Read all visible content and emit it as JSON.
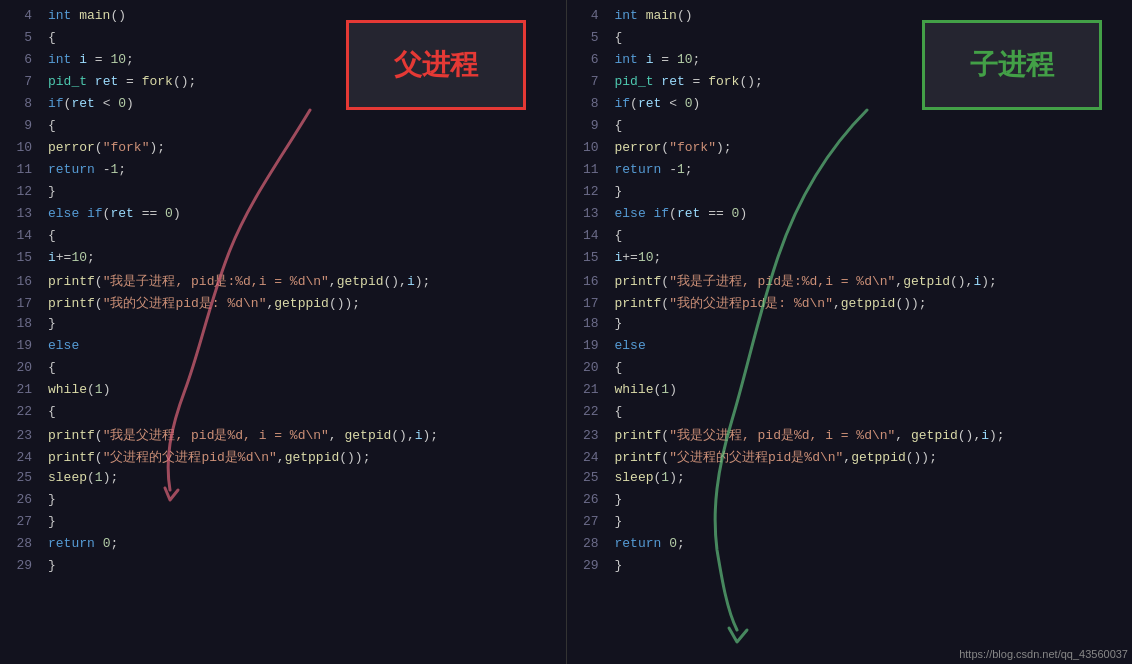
{
  "left": {
    "label": "父进程",
    "lines": [
      {
        "num": "4",
        "content": "<span class='kw'>int</span> <span class='fn'>main</span><span class='punc'>()</span>"
      },
      {
        "num": "5",
        "content": "<span class='punc'>{</span>"
      },
      {
        "num": "6",
        "content": "    <span class='kw'>int</span> <span class='var'>i</span> <span class='op'>=</span> <span class='num'>10</span><span class='punc'>;</span>"
      },
      {
        "num": "7",
        "content": "    <span class='type'>pid_t</span> <span class='var'>ret</span> <span class='op'>=</span> <span class='fn'>fork</span><span class='punc'>();</span>"
      },
      {
        "num": "8",
        "content": "    <span class='kw'>if</span><span class='punc'>(</span><span class='var'>ret</span> <span class='op'>&lt;</span> <span class='num'>0</span><span class='punc'>)</span>"
      },
      {
        "num": "9",
        "content": "    <span class='punc'>{</span>"
      },
      {
        "num": "10",
        "content": "        <span class='fn'>perror</span><span class='punc'>(</span><span class='str'>\"fork\"</span><span class='punc'>);</span>"
      },
      {
        "num": "11",
        "content": "        <span class='kw'>return</span> <span class='op'>-</span><span class='num'>1</span><span class='punc'>;</span>"
      },
      {
        "num": "12",
        "content": "    <span class='punc'>}</span>"
      },
      {
        "num": "13",
        "content": "    <span class='kw'>else if</span><span class='punc'>(</span><span class='var'>ret</span> <span class='op'>==</span> <span class='num'>0</span><span class='punc'>)</span>"
      },
      {
        "num": "14",
        "content": "    <span class='punc'>{</span>"
      },
      {
        "num": "15",
        "content": "        <span class='var'>i</span><span class='op'>+=</span><span class='num'>10</span><span class='punc'>;</span>"
      },
      {
        "num": "16",
        "content": "        <span class='fn'>printf</span><span class='punc'>(</span><span class='str'>\"我是子进程, pid是:%d,i = %d\\n\"</span><span class='punc'>,</span><span class='fn'>getpid</span><span class='punc'>(),</span><span class='var'>i</span><span class='punc'>);</span>"
      },
      {
        "num": "17",
        "content": "        <span class='fn'>printf</span><span class='punc'>(</span><span class='str'>\"我的父进程pid是: %d\\n\"</span><span class='punc'>,</span><span class='fn'>getppid</span><span class='punc'>());</span>"
      },
      {
        "num": "18",
        "content": "    <span class='punc'>}</span>"
      },
      {
        "num": "19",
        "content": "    <span class='kw'>else</span>"
      },
      {
        "num": "20",
        "content": "    <span class='punc'>{</span>"
      },
      {
        "num": "21",
        "content": "        <span class='fn'>while</span><span class='punc'>(</span><span class='num'>1</span><span class='punc'>)</span>"
      },
      {
        "num": "22",
        "content": "        <span class='punc'>{</span>"
      },
      {
        "num": "23",
        "content": "            <span class='fn'>printf</span><span class='punc'>(</span><span class='str'>\"我是父进程, pid是%d, i = %d\\n\"</span><span class='punc'>,</span> <span class='fn'>getpid</span><span class='punc'>(),</span><span class='var'>i</span><span class='punc'>);</span>"
      },
      {
        "num": "24",
        "content": "            <span class='fn'>printf</span><span class='punc'>(</span><span class='str'>\"父进程的父进程pid是%d\\n\"</span><span class='punc'>,</span><span class='fn'>getppid</span><span class='punc'>());</span>"
      },
      {
        "num": "25",
        "content": "            <span class='fn'>sleep</span><span class='punc'>(</span><span class='num'>1</span><span class='punc'>);</span>"
      },
      {
        "num": "26",
        "content": "        <span class='punc'>}</span>"
      },
      {
        "num": "27",
        "content": "    <span class='punc'>}</span>"
      },
      {
        "num": "28",
        "content": "    <span class='kw'>return</span> <span class='num'>0</span><span class='punc'>;</span>"
      },
      {
        "num": "29",
        "content": "<span class='punc'>}</span>"
      }
    ]
  },
  "right": {
    "label": "子进程",
    "lines": [
      {
        "num": "4",
        "content": "<span class='kw'>int</span> <span class='fn'>main</span><span class='punc'>()</span>"
      },
      {
        "num": "5",
        "content": "<span class='punc'>{</span>"
      },
      {
        "num": "6",
        "content": "    <span class='kw'>int</span> <span class='var'>i</span> <span class='op'>=</span> <span class='num'>10</span><span class='punc'>;</span>"
      },
      {
        "num": "7",
        "content": "    <span class='type'>pid_t</span> <span class='var'>ret</span> <span class='op'>=</span> <span class='fn'>fork</span><span class='punc'>();</span>"
      },
      {
        "num": "8",
        "content": "    <span class='kw'>if</span><span class='punc'>(</span><span class='var'>ret</span> <span class='op'>&lt;</span> <span class='num'>0</span><span class='punc'>)</span>"
      },
      {
        "num": "9",
        "content": "    <span class='punc'>{</span>"
      },
      {
        "num": "10",
        "content": "        <span class='fn'>perror</span><span class='punc'>(</span><span class='str'>\"fork\"</span><span class='punc'>);</span>"
      },
      {
        "num": "11",
        "content": "        <span class='kw'>return</span> <span class='op'>-</span><span class='num'>1</span><span class='punc'>;</span>"
      },
      {
        "num": "12",
        "content": "    <span class='punc'>}</span>"
      },
      {
        "num": "13",
        "content": "    <span class='kw'>else if</span><span class='punc'>(</span><span class='var'>ret</span> <span class='op'>==</span> <span class='num'>0</span><span class='punc'>)</span>"
      },
      {
        "num": "14",
        "content": "    <span class='punc'>{</span>"
      },
      {
        "num": "15",
        "content": "        <span class='var'>i</span><span class='op'>+=</span><span class='num'>10</span><span class='punc'>;</span>"
      },
      {
        "num": "16",
        "content": "        <span class='fn'>printf</span><span class='punc'>(</span><span class='str'>\"我是子进程, pid是:%d,i = %d\\n\"</span><span class='punc'>,</span><span class='fn'>getpid</span><span class='punc'>(),</span><span class='var'>i</span><span class='punc'>);</span>"
      },
      {
        "num": "17",
        "content": "        <span class='fn'>printf</span><span class='punc'>(</span><span class='str'>\"我的父进程pid是: %d\\n\"</span><span class='punc'>,</span><span class='fn'>getppid</span><span class='punc'>());</span>"
      },
      {
        "num": "18",
        "content": "    <span class='punc'>}</span>"
      },
      {
        "num": "19",
        "content": "    <span class='kw'>else</span>"
      },
      {
        "num": "20",
        "content": "    <span class='punc'>{</span>"
      },
      {
        "num": "21",
        "content": "        <span class='fn'>while</span><span class='punc'>(</span><span class='num'>1</span><span class='punc'>)</span>"
      },
      {
        "num": "22",
        "content": "        <span class='punc'>{</span>"
      },
      {
        "num": "23",
        "content": "            <span class='fn'>printf</span><span class='punc'>(</span><span class='str'>\"我是父进程, pid是%d, i = %d\\n\"</span><span class='punc'>,</span> <span class='fn'>getpid</span><span class='punc'>(),</span><span class='var'>i</span><span class='punc'>);</span>"
      },
      {
        "num": "24",
        "content": "            <span class='fn'>printf</span><span class='punc'>(</span><span class='str'>\"父进程的父进程pid是%d\\n\"</span><span class='punc'>,</span><span class='fn'>getppid</span><span class='punc'>());</span>"
      },
      {
        "num": "25",
        "content": "            <span class='fn'>sleep</span><span class='punc'>(</span><span class='num'>1</span><span class='punc'>);</span>"
      },
      {
        "num": "26",
        "content": "        <span class='punc'>}</span>"
      },
      {
        "num": "27",
        "content": "    <span class='punc'>}</span>"
      },
      {
        "num": "28",
        "content": "    <span class='kw'>return</span> <span class='num'>0</span><span class='punc'>;</span>"
      },
      {
        "num": "29",
        "content": "<span class='punc'>}</span>"
      }
    ]
  },
  "labels": {
    "left_label": "父进程",
    "right_label": "子进程",
    "watermark": "https://blog.csdn.net/qq_43560037"
  }
}
